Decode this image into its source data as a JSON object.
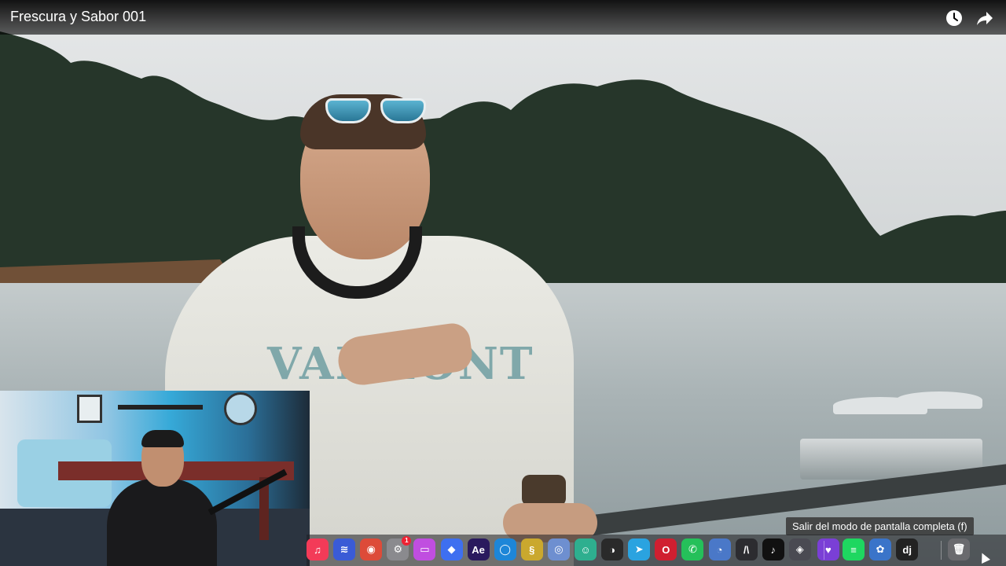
{
  "video": {
    "title": "Frescura y Sabor 001",
    "shirt_print": "VALMONT"
  },
  "player_controls": {
    "watch_later_icon": "clock-icon",
    "share_icon": "share-arrow-icon",
    "exit_fullscreen_tooltip": "Salir del modo de pantalla completa (f)"
  },
  "dock": {
    "items": [
      {
        "name": "music",
        "icon": "music-note-icon",
        "glyph": "♫",
        "color": "#f33b58"
      },
      {
        "name": "audio-app",
        "icon": "waveform-icon",
        "glyph": "≋",
        "color": "#3a5bd6"
      },
      {
        "name": "chrome",
        "icon": "chrome-icon",
        "glyph": "◉",
        "color": "#dd4b39"
      },
      {
        "name": "settings",
        "icon": "gear-icon",
        "glyph": "⚙",
        "color": "#8a8a8e",
        "badge": "1"
      },
      {
        "name": "app-purple",
        "icon": "window-icon",
        "glyph": "▭",
        "color": "#c04ee0"
      },
      {
        "name": "app-blue",
        "icon": "cube-icon",
        "glyph": "◆",
        "color": "#3e6ff0"
      },
      {
        "name": "after-effects",
        "icon": "after-effects-icon",
        "glyph": "Ae",
        "color": "#2a1a5e"
      },
      {
        "name": "circle-app",
        "icon": "ring-icon",
        "glyph": "◯",
        "color": "#1d86d8"
      },
      {
        "name": "python",
        "icon": "python-icon",
        "glyph": "§",
        "color": "#caa82e"
      },
      {
        "name": "drv",
        "icon": "drive-icon",
        "glyph": "◎",
        "color": "#6e8fd0"
      },
      {
        "name": "discord-like",
        "icon": "chat-bot-icon",
        "glyph": "☺",
        "color": "#2eaf8f"
      },
      {
        "name": "obs",
        "icon": "obs-icon",
        "glyph": "◑",
        "color": "#2a2a2a"
      },
      {
        "name": "telegram",
        "icon": "telegram-icon",
        "glyph": "➤",
        "color": "#2aa3e0"
      },
      {
        "name": "opera",
        "icon": "opera-icon",
        "glyph": "O",
        "color": "#d01f30"
      },
      {
        "name": "whatsapp",
        "icon": "whatsapp-icon",
        "glyph": "✆",
        "color": "#25c05a"
      },
      {
        "name": "gauge",
        "icon": "speedometer-icon",
        "glyph": "◔",
        "color": "#4a78c8"
      },
      {
        "name": "vector-app",
        "icon": "vector-icon",
        "glyph": "/\\",
        "color": "#2c2c30"
      },
      {
        "name": "tiktok",
        "icon": "tiktok-icon",
        "glyph": "♪",
        "color": "#111111"
      },
      {
        "name": "tool-app",
        "icon": "tool-icon",
        "glyph": "◈",
        "color": "#4a4a52"
      },
      {
        "name": "heart-app",
        "icon": "heart-icon",
        "glyph": "♥",
        "color": "#7a3fd6"
      },
      {
        "name": "spotify",
        "icon": "spotify-icon",
        "glyph": "≡",
        "color": "#1ed760"
      },
      {
        "name": "flower-app",
        "icon": "flower-icon",
        "glyph": "✿",
        "color": "#3a74c9"
      },
      {
        "name": "dj-app",
        "icon": "dj-icon",
        "glyph": "dj",
        "color": "#222222"
      },
      {
        "name": "trash",
        "icon": "trash-icon",
        "glyph": "🗑",
        "color": "#6a6a6e"
      }
    ]
  }
}
